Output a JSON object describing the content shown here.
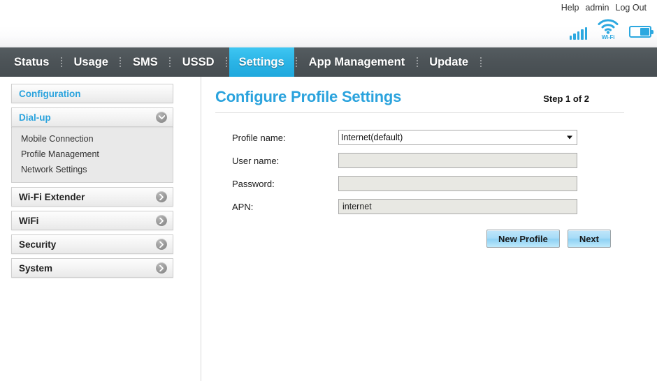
{
  "header": {
    "links": [
      {
        "label": "Help",
        "name": "help-link"
      },
      {
        "label": "admin",
        "name": "admin-user"
      },
      {
        "label": "Log Out",
        "name": "logout-link"
      }
    ],
    "icons": {
      "signal": "signal-bars-icon",
      "wifi": "wifi-icon",
      "wifi_label": "Wi-Fi",
      "battery": "battery-icon"
    },
    "accent_color": "#2ca8e0"
  },
  "nav": {
    "active": "Settings",
    "items": [
      {
        "label": "Status",
        "name": "nav-status"
      },
      {
        "label": "Usage",
        "name": "nav-usage"
      },
      {
        "label": "SMS",
        "name": "nav-sms"
      },
      {
        "label": "USSD",
        "name": "nav-ussd"
      },
      {
        "label": "Settings",
        "name": "nav-settings"
      },
      {
        "label": "App Management",
        "name": "nav-app-management"
      },
      {
        "label": "Update",
        "name": "nav-update"
      }
    ],
    "bg_color": "#4c5357",
    "active_color": "#2bb4e6"
  },
  "sidebar": {
    "configuration": "Configuration",
    "dialup": {
      "label": "Dial-up",
      "expanded": true,
      "items": [
        {
          "label": "Mobile Connection",
          "name": "sidebar-item-mobile-connection"
        },
        {
          "label": "Profile Management",
          "name": "sidebar-item-profile-management"
        },
        {
          "label": "Network Settings",
          "name": "sidebar-item-network-settings"
        }
      ]
    },
    "groups": [
      {
        "label": "Wi-Fi Extender",
        "name": "sidebar-group-wifi-extender"
      },
      {
        "label": "WiFi",
        "name": "sidebar-group-wifi"
      },
      {
        "label": "Security",
        "name": "sidebar-group-security"
      },
      {
        "label": "System",
        "name": "sidebar-group-system"
      }
    ]
  },
  "main": {
    "title": "Configure Profile Settings",
    "step": "Step 1 of 2",
    "title_color": "#2ba3dd",
    "fields": {
      "profile_name": {
        "label": "Profile name:",
        "value": "Internet(default)",
        "options": [
          "Internet(default)"
        ]
      },
      "user_name": {
        "label": "User name:",
        "value": "",
        "placeholder": ""
      },
      "password": {
        "label": "Password:",
        "value": "",
        "placeholder": ""
      },
      "apn": {
        "label": "APN:",
        "value": "internet",
        "placeholder": ""
      }
    },
    "buttons": {
      "new_profile": "New Profile",
      "next": "Next"
    }
  }
}
